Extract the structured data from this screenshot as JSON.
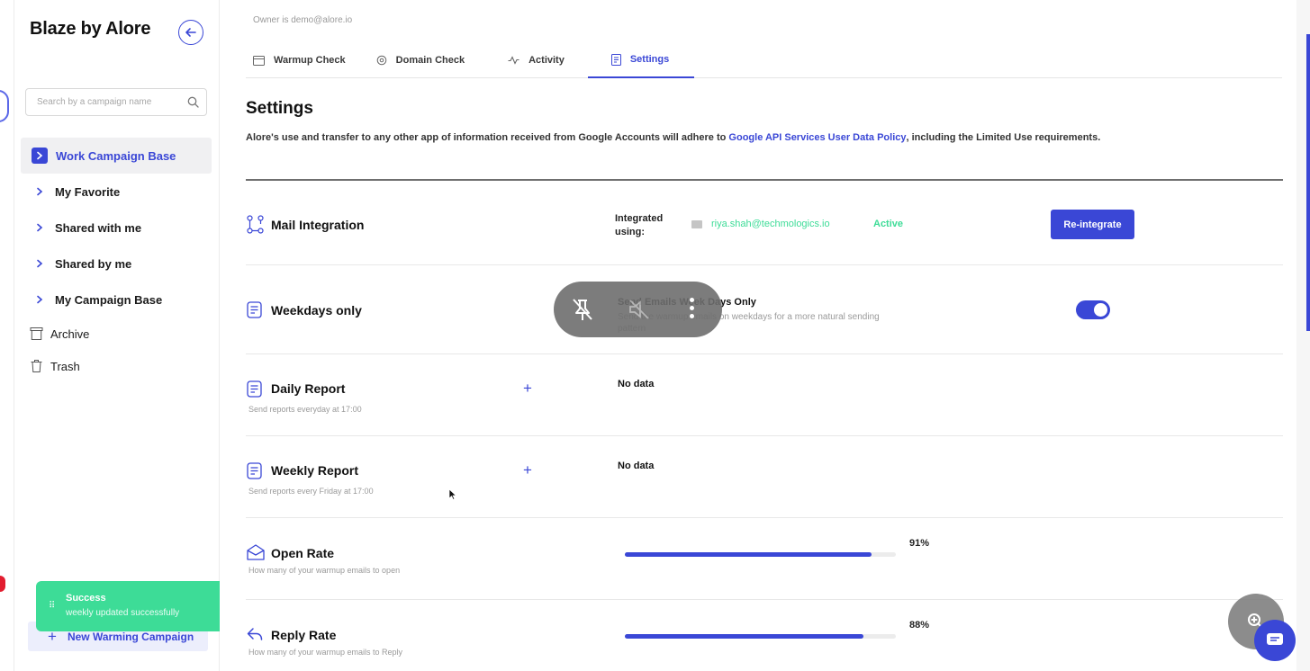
{
  "sidebar": {
    "brand": "Blaze by Alore",
    "search_placeholder": "Search by a campaign name",
    "nav": [
      {
        "label": "Work Campaign Base",
        "active": true
      },
      {
        "label": "My Favorite"
      },
      {
        "label": "Shared with me"
      },
      {
        "label": "Shared by me"
      },
      {
        "label": "My Campaign Base"
      }
    ],
    "archive_label": "Archive",
    "trash_label": "Trash",
    "new_campaign_label": "New Warming Campaign"
  },
  "toast": {
    "title": "Success",
    "message": "weekly updated successfully",
    "close": "×"
  },
  "header": {
    "owner": "Owner is demo@alore.io",
    "tabs": [
      {
        "label": "Warmup Check",
        "icon": "calendar-icon"
      },
      {
        "label": "Domain Check",
        "icon": "gear-icon"
      },
      {
        "label": "Activity",
        "icon": "activity-icon"
      },
      {
        "label": "Settings",
        "icon": "settings-doc-icon",
        "active": true
      }
    ]
  },
  "settings": {
    "title": "Settings",
    "policy_prefix": "Alore's use and transfer to any other app of information received from Google Accounts will adhere to ",
    "policy_link": "Google API Services User Data Policy",
    "policy_suffix": ", including the Limited Use requirements.",
    "mail_integration": {
      "title": "Mail Integration",
      "integrated_label_1": "Integrated",
      "integrated_label_2": "using:",
      "email": "riya.shah@techmologics.io",
      "status": "Active",
      "button": "Re-integrate"
    },
    "weekdays": {
      "title": "Weekdays only",
      "option_title": "Send Emails Week Days Only",
      "option_desc": "Send the warmup emails on weekdays for a more natural sending pattern",
      "enabled": true
    },
    "daily_report": {
      "title": "Daily Report",
      "subtitle": "Send reports everyday at 17:00",
      "value": "No data"
    },
    "weekly_report": {
      "title": "Weekly Report",
      "subtitle": "Send reports every Friday at 17:00",
      "value": "No data"
    },
    "open_rate": {
      "title": "Open Rate",
      "subtitle": "How many of your warmup emails to open",
      "percent_label": "91%",
      "fraction": 0.91
    },
    "reply_rate": {
      "title": "Reply Rate",
      "subtitle": "How many of your warmup emails to Reply",
      "percent_label": "88%",
      "fraction": 0.88
    }
  },
  "colors": {
    "accent": "#3a47d6",
    "success": "#3ddc97"
  }
}
